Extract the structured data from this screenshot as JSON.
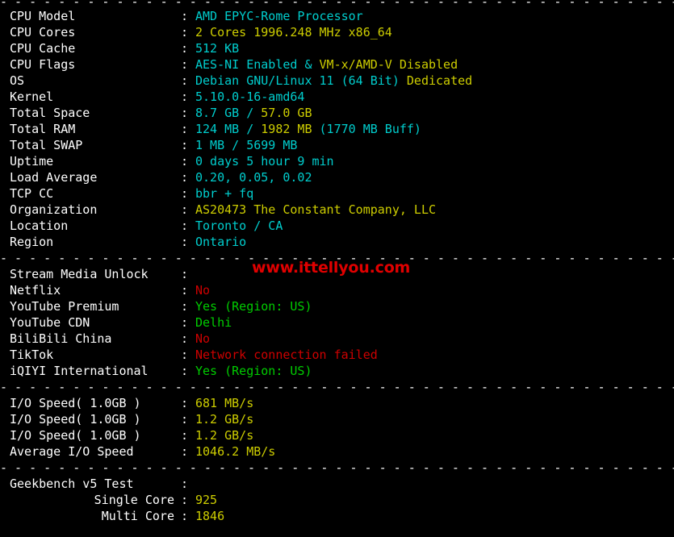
{
  "terminal": {
    "separator": "- - - - - - - - - - - - - - - - - - - - - - - - - - - - - - - - - - - - - - - - - - - - - - - - - - - - - - - - - - - - - - - - - - - - - - - - - - - - - - - - - - - - - - - - - - - - - - - - - - - - - - - - - - - - - - - - - -",
    "colon": ":"
  },
  "watermark": {
    "text": "www.ittellyou.com",
    "color": "#e00000"
  },
  "colors": {
    "background": "#000000",
    "label": "#ffffff",
    "cyan": "#00cdcd",
    "yellow": "#cdcd00",
    "green": "#00cd00",
    "red": "#cd0000"
  },
  "system": [
    {
      "label": "CPU Model",
      "segments": [
        {
          "text": "AMD EPYC-Rome Processor",
          "color": "cyan"
        }
      ]
    },
    {
      "label": "CPU Cores",
      "segments": [
        {
          "text": "2 Cores 1996.248 MHz x86_64",
          "color": "yellow"
        }
      ]
    },
    {
      "label": "CPU Cache",
      "segments": [
        {
          "text": "512 KB",
          "color": "cyan"
        }
      ]
    },
    {
      "label": "CPU Flags",
      "segments": [
        {
          "text": "AES-NI Enabled & ",
          "color": "cyan"
        },
        {
          "text": "VM-x/AMD-V Disabled",
          "color": "yellow"
        }
      ]
    },
    {
      "label": "OS",
      "segments": [
        {
          "text": "Debian GNU/Linux 11 (64 Bit) ",
          "color": "cyan"
        },
        {
          "text": "Dedicated",
          "color": "yellow"
        }
      ]
    },
    {
      "label": "Kernel",
      "segments": [
        {
          "text": "5.10.0-16-amd64",
          "color": "cyan"
        }
      ]
    },
    {
      "label": "Total Space",
      "segments": [
        {
          "text": "8.7 GB / ",
          "color": "cyan"
        },
        {
          "text": "57.0 GB",
          "color": "yellow"
        }
      ]
    },
    {
      "label": "Total RAM",
      "segments": [
        {
          "text": "124 MB / ",
          "color": "cyan"
        },
        {
          "text": "1982 MB ",
          "color": "yellow"
        },
        {
          "text": "(1770 MB Buff)",
          "color": "cyan"
        }
      ]
    },
    {
      "label": "Total SWAP",
      "segments": [
        {
          "text": "1 MB / 5699 MB",
          "color": "cyan"
        }
      ]
    },
    {
      "label": "Uptime",
      "segments": [
        {
          "text": "0 days 5 hour 9 min",
          "color": "cyan"
        }
      ]
    },
    {
      "label": "Load Average",
      "segments": [
        {
          "text": "0.20, 0.05, 0.02",
          "color": "cyan"
        }
      ]
    },
    {
      "label": "TCP CC",
      "segments": [
        {
          "text": "bbr + fq",
          "color": "cyan"
        }
      ]
    },
    {
      "label": "Organization",
      "segments": [
        {
          "text": "AS20473 The Constant Company, LLC",
          "color": "yellow"
        }
      ]
    },
    {
      "label": "Location",
      "segments": [
        {
          "text": "Toronto / CA",
          "color": "cyan"
        }
      ]
    },
    {
      "label": "Region",
      "segments": [
        {
          "text": "Ontario",
          "color": "cyan"
        }
      ]
    }
  ],
  "stream": [
    {
      "label": "Stream Media Unlock",
      "segments": []
    },
    {
      "label": "Netflix",
      "segments": [
        {
          "text": "No",
          "color": "red"
        }
      ]
    },
    {
      "label": "YouTube Premium",
      "segments": [
        {
          "text": "Yes (Region: US)",
          "color": "green"
        }
      ]
    },
    {
      "label": "YouTube CDN",
      "segments": [
        {
          "text": "Delhi",
          "color": "green"
        }
      ]
    },
    {
      "label": "BiliBili China",
      "segments": [
        {
          "text": "No",
          "color": "red"
        }
      ]
    },
    {
      "label": "TikTok",
      "segments": [
        {
          "text": "Network connection failed",
          "color": "red"
        }
      ]
    },
    {
      "label": "iQIYI International",
      "segments": [
        {
          "text": "Yes (Region: US)",
          "color": "green"
        }
      ]
    }
  ],
  "io": [
    {
      "label": "I/O Speed( 1.0GB )",
      "segments": [
        {
          "text": "681 MB/s",
          "color": "yellow"
        }
      ]
    },
    {
      "label": "I/O Speed( 1.0GB )",
      "segments": [
        {
          "text": "1.2 GB/s",
          "color": "yellow"
        }
      ]
    },
    {
      "label": "I/O Speed( 1.0GB )",
      "segments": [
        {
          "text": "1.2 GB/s",
          "color": "yellow"
        }
      ]
    },
    {
      "label": "Average I/O Speed",
      "segments": [
        {
          "text": "1046.2 MB/s",
          "color": "yellow"
        }
      ]
    }
  ],
  "geekbench": [
    {
      "label": "Geekbench v5 Test",
      "indent": false,
      "segments": []
    },
    {
      "label": "Single Core",
      "indent": true,
      "segments": [
        {
          "text": "925",
          "color": "yellow"
        }
      ]
    },
    {
      "label": "Multi Core",
      "indent": true,
      "segments": [
        {
          "text": "1846",
          "color": "yellow"
        }
      ]
    }
  ]
}
